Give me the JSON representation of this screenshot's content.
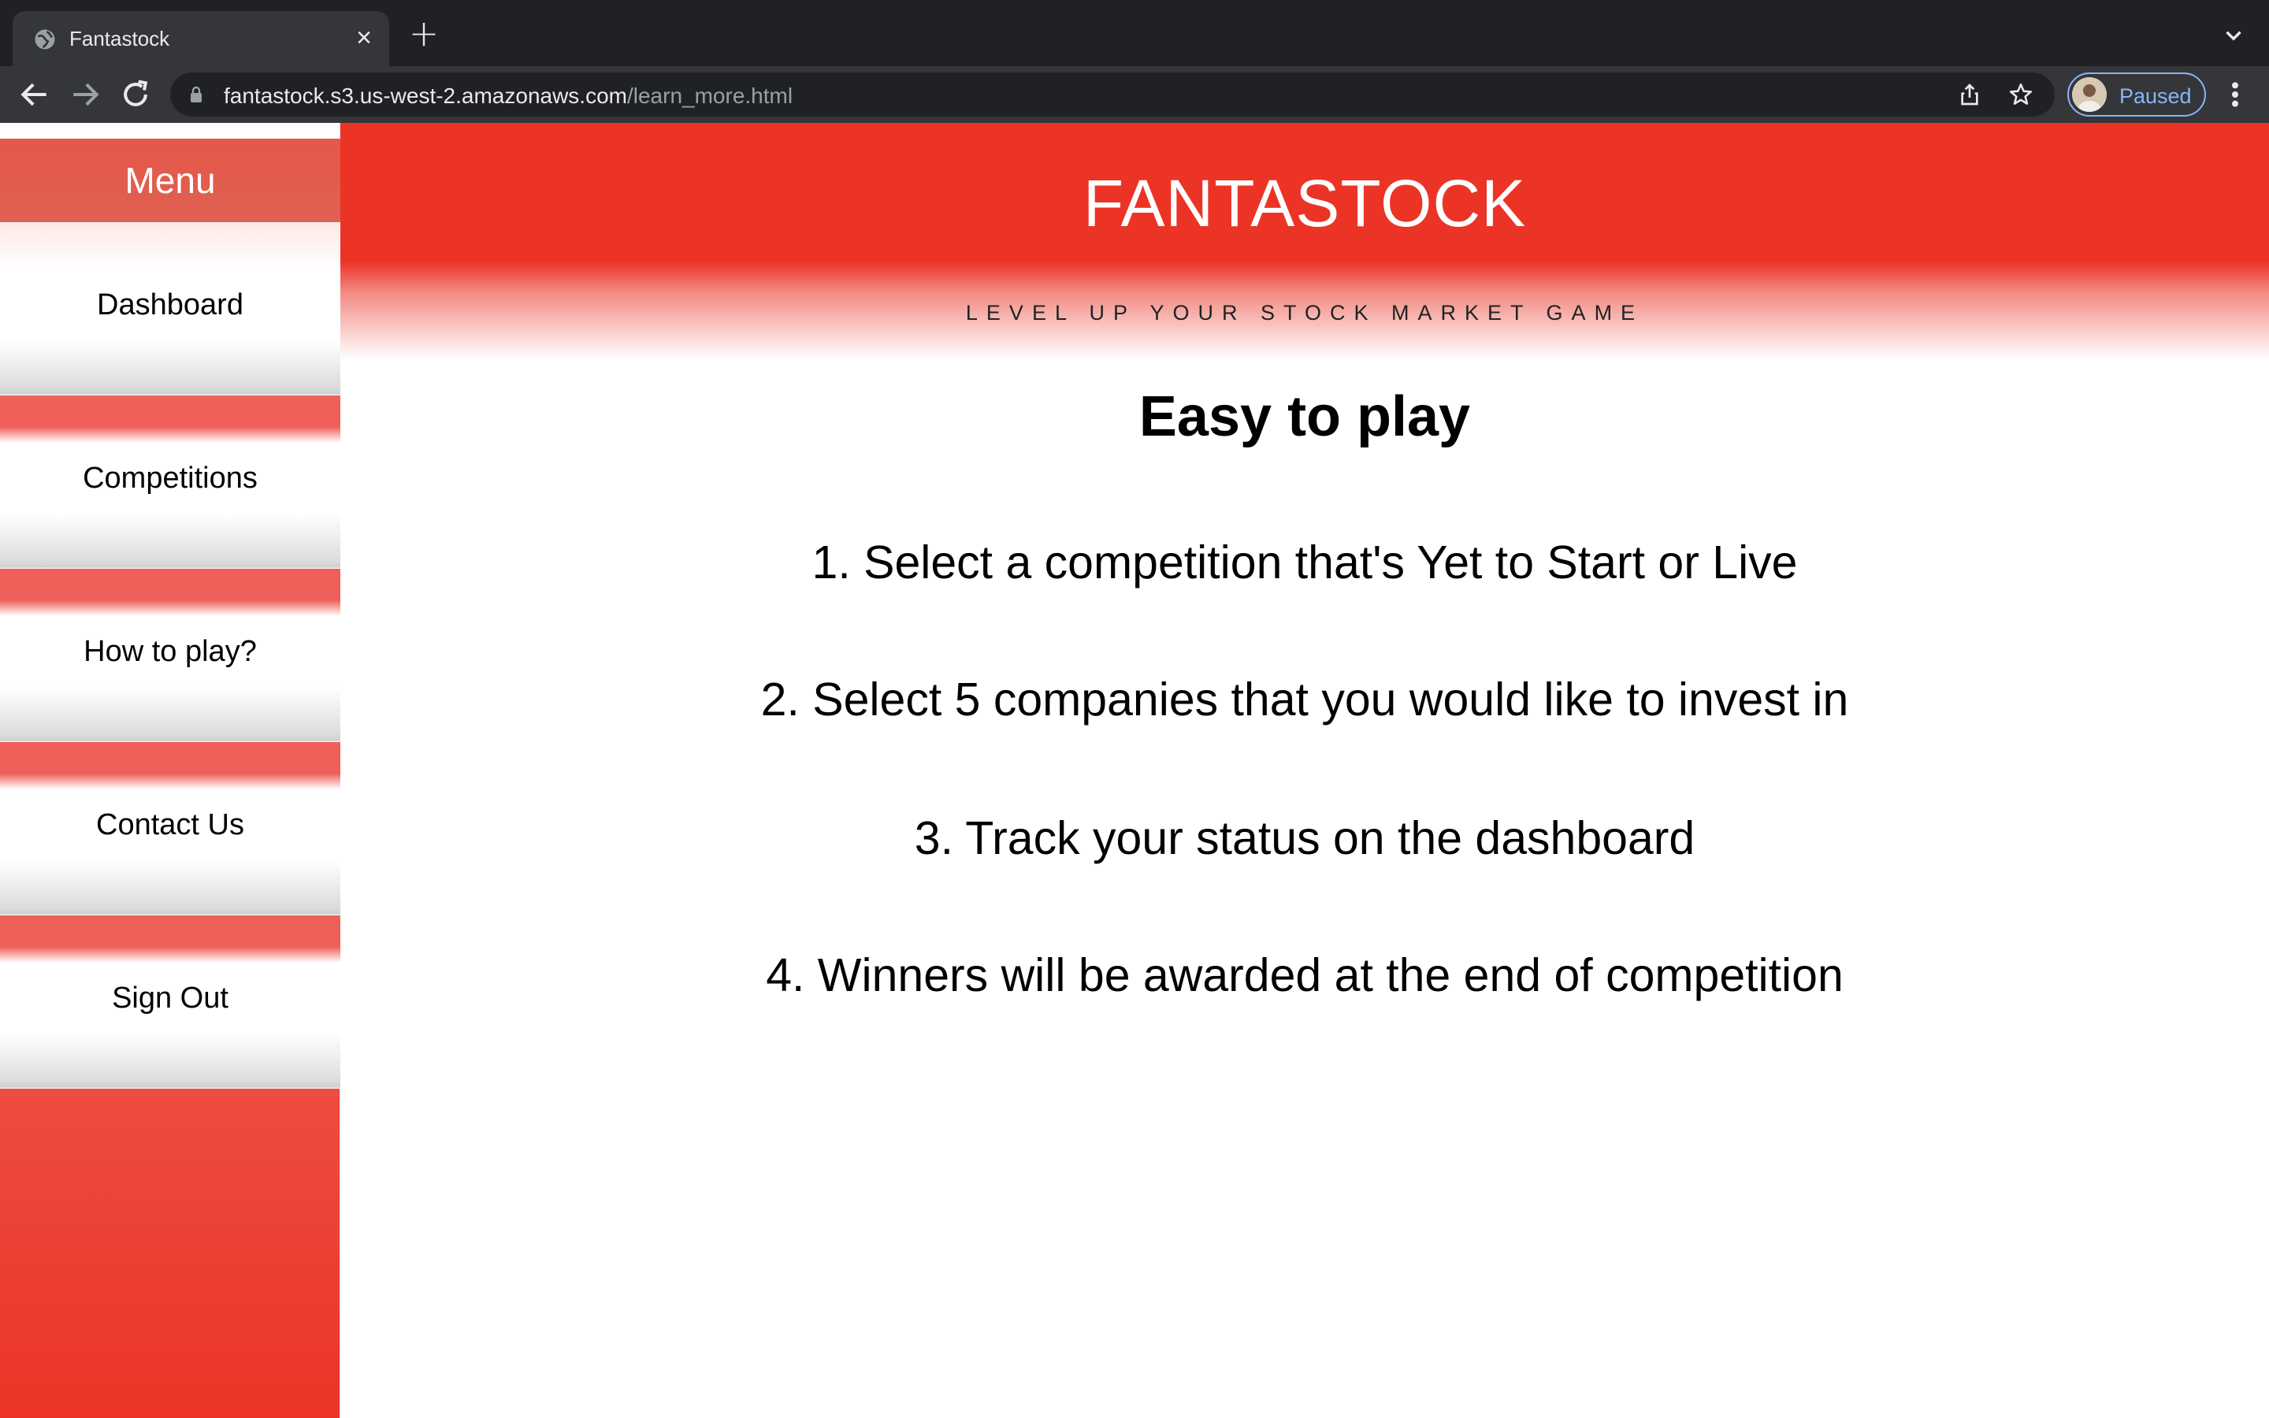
{
  "browser": {
    "tab_title": "Fantastock",
    "url_host": "fantastock.s3.us-west-2.amazonaws.com",
    "url_path": "/learn_more.html",
    "profile_label": "Paused",
    "icons": [
      "globe-icon",
      "close-icon",
      "plus-icon",
      "chevron-down-icon",
      "back-arrow-icon",
      "forward-arrow-icon",
      "reload-icon",
      "lock-icon",
      "share-icon",
      "star-icon",
      "avatar",
      "kebab-menu-icon"
    ]
  },
  "sidebar": {
    "header": "Menu",
    "items": [
      {
        "label": "Dashboard"
      },
      {
        "label": "Competitions"
      },
      {
        "label": "How to play?"
      },
      {
        "label": "Contact Us"
      },
      {
        "label": "Sign Out"
      }
    ]
  },
  "hero": {
    "brand": "FANTASTOCK",
    "tagline": "LEVEL UP YOUR STOCK MARKET GAME"
  },
  "content": {
    "heading": "Easy to play",
    "steps": [
      "1. Select a competition that's Yet to Start or Live",
      "2. Select 5 companies that you would like to invest in",
      "3. Track your status on the dashboard",
      "4. Winners will be awarded at the end of competition"
    ]
  },
  "colors": {
    "brand_red": "#eb3426",
    "chrome_dark": "#202124",
    "chrome_toolbar": "#35363a",
    "profile_accent": "#8ab4f8"
  }
}
